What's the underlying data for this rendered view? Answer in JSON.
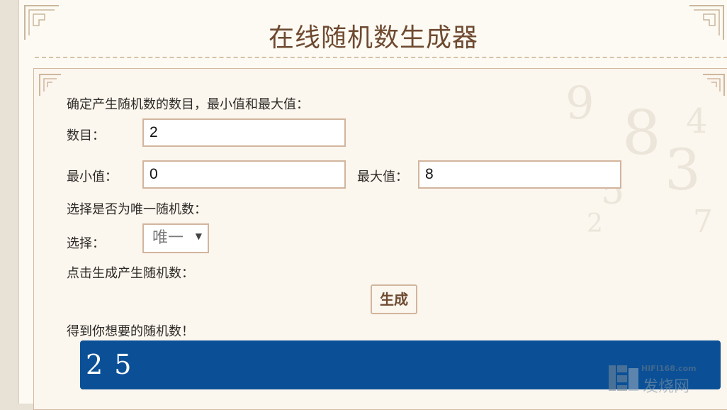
{
  "page": {
    "title": "在线随机数生成器"
  },
  "form": {
    "intro": "确定产生随机数的数目，最小值和最大值：",
    "count_label": "数目：",
    "count_value": "2",
    "min_label": "最小值：",
    "min_value": "0",
    "max_label": "最大值：",
    "max_value": "8",
    "unique_prompt": "选择是否为唯一随机数：",
    "select_label": "选择：",
    "select_value": "唯一",
    "generate_prompt": "点击生成产生随机数：",
    "generate_button": "生成",
    "result_label": "得到你想要的随机数！",
    "result_value": "2 5"
  },
  "watermark": {
    "url": "HIFI168.com",
    "name": "发烧网"
  },
  "colors": {
    "title": "#6e4a31",
    "field_border": "#d2b59e",
    "result_bg": "#0b5096",
    "page_bg": "#fdfaf3"
  },
  "icons": [
    "corner-ornament-icon",
    "select-arrow-icon",
    "watermark-logo-icon"
  ]
}
